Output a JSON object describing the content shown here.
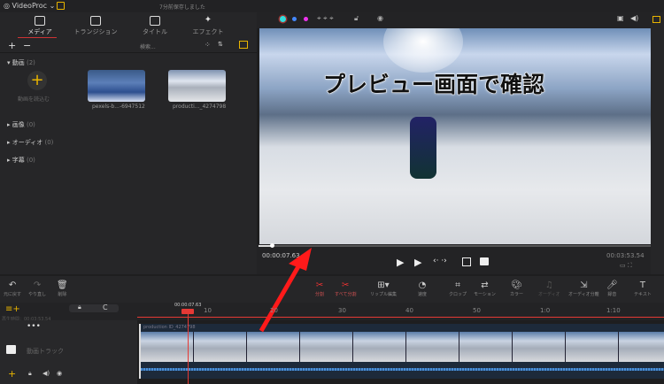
{
  "app": {
    "title": "VideoProc",
    "save_status": "7分前保存しました"
  },
  "left_tabs": [
    {
      "label": "メディア",
      "active": true
    },
    {
      "label": "トランジション"
    },
    {
      "label": "タイトル"
    },
    {
      "label": "エフェクト"
    }
  ],
  "media_toolbar": {
    "search_placeholder": "検索..."
  },
  "sections": [
    {
      "label": "動画",
      "count": "(2)",
      "expanded": true
    },
    {
      "label": "画像",
      "count": "(0)"
    },
    {
      "label": "オーディオ",
      "count": "(0)"
    },
    {
      "label": "字幕",
      "count": "(0)"
    }
  ],
  "import_label": "動画を読込む",
  "media_items": [
    {
      "name": "pexels-b...-6947512"
    },
    {
      "name": "producti..._4274798"
    }
  ],
  "preview": {
    "overlay_text": "プレビュー画面で確認",
    "current_time": "00:00:07.63",
    "total_time": "00:03:53.54",
    "progress_percent": 3.3
  },
  "edit_tools": {
    "undo": "元に戻す",
    "redo": "やり直し",
    "delete": "削除",
    "split": "分割",
    "split_all": "すべて分割",
    "ripple": "リップル編集",
    "speed": "速度",
    "crop": "クロップ",
    "motion": "モーション",
    "color": "カラー",
    "audio": "オーディオ",
    "audio_split": "オーディオ分離",
    "record": "録音",
    "text": "テキスト"
  },
  "timeline": {
    "playhead_time": "00:00:07.63",
    "duration_label": "再生時間：00:03:53.54",
    "ruler": [
      "10",
      "20",
      "30",
      "40",
      "50",
      "1:0",
      "1:10"
    ],
    "track_label": "動画トラック",
    "clip_name": "production ID_4274798"
  },
  "colors": {
    "accent": "#e8b400",
    "playhead": "#e53935",
    "arrow": "#ff1a1a"
  }
}
